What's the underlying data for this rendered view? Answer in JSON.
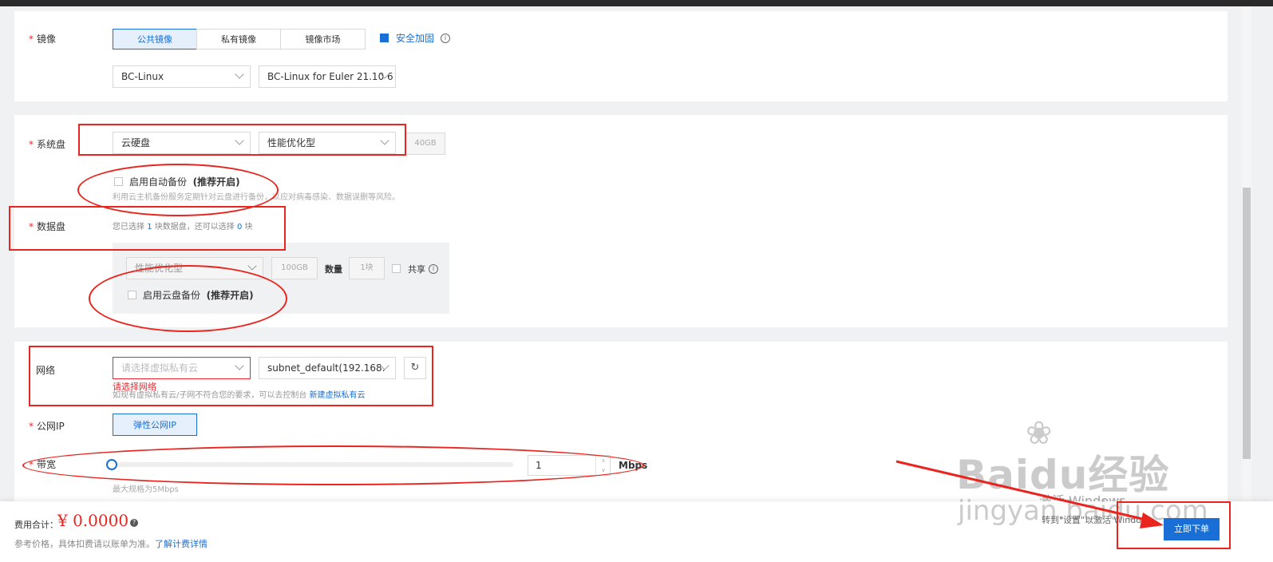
{
  "image_section": {
    "label": "镜像",
    "tabs": [
      "公共镜像",
      "私有镜像",
      "镜像市场"
    ],
    "active_tab": 0,
    "security_label": "安全加固",
    "os_select": "BC-Linux",
    "version_select": "BC-Linux for Euler 21.10 6"
  },
  "system_disk": {
    "label": "系统盘",
    "type_select": "云硬盘",
    "perf_select": "性能优化型",
    "size": "40GB",
    "backup_label": "启用自动备份",
    "backup_recommend": "(推荐开启)",
    "backup_hint": "利用云主机备份服务定期针对云盘进行备份，以应对病毒感染、数据误删等风险。"
  },
  "data_disk": {
    "label": "数据盘",
    "status_prefix": "您已选择",
    "selected_count": "1",
    "status_mid": "块数据盘，还可以选择",
    "remaining_count": "0",
    "status_suffix": "块",
    "perf_select": "性能优化型",
    "size": "100GB",
    "quantity_label": "数量",
    "quantity_value": "1块",
    "share_label": "共享",
    "backup_label": "启用云盘备份",
    "backup_recommend": "(推荐开启)"
  },
  "network": {
    "label": "网络",
    "vpc_placeholder": "请选择虚拟私有云",
    "subnet_select": "subnet_default(192.168.",
    "error": "请选择网络",
    "hint_prefix": "如现有虚拟私有云/子网不符合您的要求，可以去控制台",
    "hint_link": "新建虚拟私有云"
  },
  "public_ip": {
    "label": "公网IP",
    "button": "弹性公网IP"
  },
  "bandwidth": {
    "label": "带宽",
    "value": "1",
    "unit": "Mbps",
    "hint": "最大规格为5Mbps",
    "slider_level": 0
  },
  "footer": {
    "total_label": "费用合计：",
    "price": "¥ 0.0000",
    "note": "参考价格，具体扣费请以账单为准。",
    "note_link": "了解计费详情",
    "order_button": "立即下单"
  },
  "watermark": {
    "brand": "Baidu经验",
    "domain": "jingyan.baidu.com",
    "activate_title": "激活 Windows",
    "activate_hint": "转到\"设置\"以激活 Windows。"
  },
  "colors": {
    "primary": "#1a6fd6",
    "annotation_red": "#e8251f",
    "price_red": "#e8251f",
    "required_star": "#f5222d"
  }
}
